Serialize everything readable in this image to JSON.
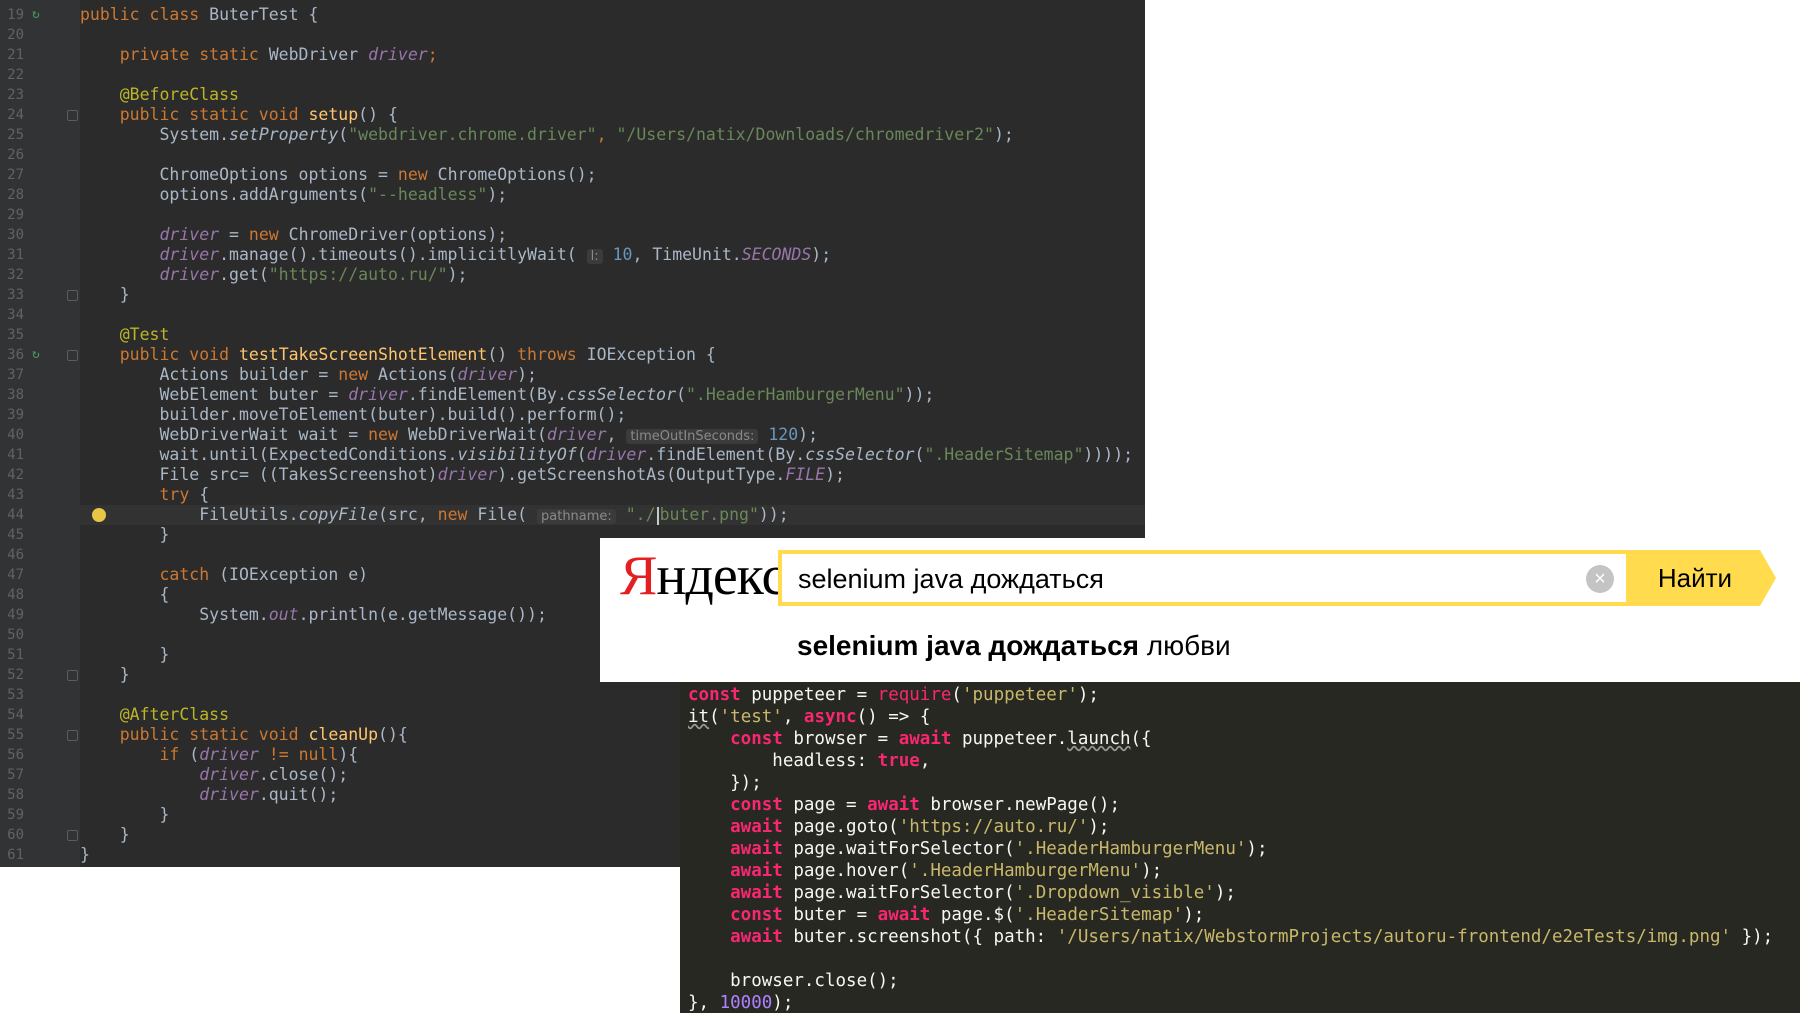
{
  "java_editor": {
    "lines": [
      {
        "n": "19",
        "t": [
          [
            "k",
            "public class "
          ],
          [
            "",
            "ButerTest {"
          ]
        ]
      },
      {
        "n": "20",
        "t": []
      },
      {
        "n": "21",
        "t": [
          [
            "k",
            "    private static "
          ],
          [
            "",
            "WebDriver "
          ],
          [
            "pi",
            "driver"
          ],
          [
            "k",
            ";"
          ]
        ]
      },
      {
        "n": "22",
        "t": []
      },
      {
        "n": "23",
        "t": [
          [
            "a",
            "    @BeforeClass"
          ]
        ]
      },
      {
        "n": "24",
        "t": [
          [
            "k",
            "    public static void "
          ],
          [
            "f",
            "setup"
          ],
          [
            "",
            "() {"
          ]
        ]
      },
      {
        "n": "25",
        "t": [
          [
            "",
            "        System."
          ],
          [
            "i",
            "setProperty"
          ],
          [
            "",
            "("
          ],
          [
            "s",
            "\"webdriver.chrome.driver\""
          ],
          [
            "k",
            ", "
          ],
          [
            "s",
            "\"/Users/natix/Downloads/chromedriver2\""
          ],
          [
            "",
            ");"
          ]
        ]
      },
      {
        "n": "26",
        "t": []
      },
      {
        "n": "27",
        "t": [
          [
            "",
            "        ChromeOptions options = "
          ],
          [
            "k",
            "new "
          ],
          [
            "",
            "ChromeOptions();"
          ]
        ]
      },
      {
        "n": "28",
        "t": [
          [
            "",
            "        options.addArguments("
          ],
          [
            "s",
            "\"--headless\""
          ],
          [
            "",
            ");"
          ]
        ]
      },
      {
        "n": "29",
        "t": []
      },
      {
        "n": "30",
        "t": [
          [
            "pi",
            "        driver"
          ],
          [
            "",
            ""
          ],
          [
            "",
            " = "
          ],
          [
            "k",
            "new "
          ],
          [
            "",
            "ChromeDriver(options);"
          ]
        ]
      },
      {
        "n": "31",
        "t": [
          [
            "pi",
            "        driver"
          ],
          [
            "",
            ".manage().timeouts().implicitlyWait( "
          ],
          [
            "h",
            "l:"
          ],
          [
            "n",
            " 10"
          ],
          [
            "",
            ", TimeUnit."
          ],
          [
            "pi",
            "SECONDS"
          ],
          [
            "",
            ");"
          ]
        ]
      },
      {
        "n": "32",
        "t": [
          [
            "pi",
            "        driver"
          ],
          [
            "",
            ".get("
          ],
          [
            "s",
            "\"https://auto.ru/\""
          ],
          [
            "",
            ");"
          ]
        ]
      },
      {
        "n": "33",
        "t": [
          [
            "",
            "    }"
          ]
        ]
      },
      {
        "n": "34",
        "t": []
      },
      {
        "n": "35",
        "t": [
          [
            "a",
            "    @Test"
          ]
        ]
      },
      {
        "n": "36",
        "t": [
          [
            "k",
            "    public void "
          ],
          [
            "f",
            "testTakeScreenShotElement"
          ],
          [
            "",
            "() "
          ],
          [
            "k",
            "throws "
          ],
          [
            "",
            "IOException {"
          ]
        ]
      },
      {
        "n": "37",
        "t": [
          [
            "",
            "        Actions builder = "
          ],
          [
            "k",
            "new "
          ],
          [
            "",
            "Actions("
          ],
          [
            "pi",
            "driver"
          ],
          [
            "",
            ");"
          ]
        ]
      },
      {
        "n": "38",
        "t": [
          [
            "",
            "        WebElement buter = "
          ],
          [
            "pi",
            "driver"
          ],
          [
            "",
            ".findElement(By."
          ],
          [
            "i",
            "cssSelector"
          ],
          [
            "",
            "("
          ],
          [
            "s",
            "\".HeaderHamburgerMenu\""
          ],
          [
            "",
            "));"
          ]
        ]
      },
      {
        "n": "39",
        "t": [
          [
            "",
            "        builder.moveToElement(buter).build().perform();"
          ]
        ]
      },
      {
        "n": "40",
        "t": [
          [
            "",
            "        WebDriverWait wait = "
          ],
          [
            "k",
            "new "
          ],
          [
            "",
            "WebDriverWait("
          ],
          [
            "pi",
            "driver"
          ],
          [
            "",
            ", "
          ],
          [
            "h",
            "timeOutInSeconds:"
          ],
          [
            "n",
            " 120"
          ],
          [
            "",
            ");"
          ]
        ]
      },
      {
        "n": "41",
        "t": [
          [
            "",
            "        wait.until(ExpectedConditions."
          ],
          [
            "i",
            "visibilityOf"
          ],
          [
            "",
            "("
          ],
          [
            "pi",
            "driver"
          ],
          [
            "",
            ".findElement(By."
          ],
          [
            "i",
            "cssSelector"
          ],
          [
            "",
            "("
          ],
          [
            "s",
            "\".HeaderSitemap\""
          ],
          [
            "",
            "))));"
          ]
        ]
      },
      {
        "n": "42",
        "t": [
          [
            "",
            "        File src= ((TakesScreenshot)"
          ],
          [
            "pi",
            "driver"
          ],
          [
            "",
            ").getScreenshotAs(OutputType."
          ],
          [
            "pi",
            "FILE"
          ],
          [
            "",
            ");"
          ]
        ]
      },
      {
        "n": "43",
        "t": [
          [
            "k",
            "        try "
          ],
          [
            "",
            "{"
          ]
        ]
      },
      {
        "n": "44",
        "t": [
          [
            "",
            "            FileUtils."
          ],
          [
            "i",
            "copyFile"
          ],
          [
            "",
            "(src, "
          ],
          [
            "k",
            "new "
          ],
          [
            "",
            "File( "
          ],
          [
            "h",
            "pathname:"
          ],
          [
            "s",
            " \"./"
          ],
          [
            "c",
            ""
          ],
          [
            "s",
            "buter.png\""
          ],
          [
            "",
            "));"
          ]
        ]
      },
      {
        "n": "45",
        "t": [
          [
            "",
            "        }"
          ]
        ]
      },
      {
        "n": "46",
        "t": []
      },
      {
        "n": "47",
        "t": [
          [
            "k",
            "        catch "
          ],
          [
            "",
            "(IOException e)"
          ]
        ]
      },
      {
        "n": "48",
        "t": [
          [
            "",
            "        {"
          ]
        ]
      },
      {
        "n": "49",
        "t": [
          [
            "",
            "            System."
          ],
          [
            "pi",
            "out"
          ],
          [
            "",
            ".println(e.getMessage());"
          ]
        ]
      },
      {
        "n": "50",
        "t": []
      },
      {
        "n": "51",
        "t": [
          [
            "",
            "        }"
          ]
        ]
      },
      {
        "n": "52",
        "t": [
          [
            "",
            "    }"
          ]
        ]
      },
      {
        "n": "53",
        "t": []
      },
      {
        "n": "54",
        "t": [
          [
            "a",
            "    @AfterClass"
          ]
        ]
      },
      {
        "n": "55",
        "t": [
          [
            "k",
            "    public static void "
          ],
          [
            "f",
            "cleanUp"
          ],
          [
            "",
            "(){"
          ]
        ]
      },
      {
        "n": "56",
        "t": [
          [
            "k",
            "        if "
          ],
          [
            "",
            "("
          ],
          [
            "pi",
            "driver"
          ],
          [
            "k",
            " != null"
          ],
          [
            "",
            "){"
          ]
        ]
      },
      {
        "n": "57",
        "t": [
          [
            "pi",
            "            driver"
          ],
          [
            "",
            ".close();"
          ]
        ]
      },
      {
        "n": "58",
        "t": [
          [
            "pi",
            "            driver"
          ],
          [
            "",
            ".quit();"
          ]
        ]
      },
      {
        "n": "59",
        "t": [
          [
            "",
            "        }"
          ]
        ]
      },
      {
        "n": "60",
        "t": [
          [
            "",
            "    }"
          ]
        ]
      },
      {
        "n": "61",
        "t": [
          [
            "",
            "}"
          ]
        ]
      }
    ]
  },
  "yandex": {
    "logo_first": "Я",
    "logo_rest": "ндекс",
    "query": "selenium java дождаться",
    "clear_symbol": "×",
    "search_button": "Найти",
    "suggestion_bold": "selenium java дождаться",
    "suggestion_rest": " любви"
  },
  "js_editor": {
    "lines": [
      {
        "t": [
          [
            "jk",
            "const "
          ],
          [
            "",
            "puppeteer = "
          ],
          [
            "jm",
            "require"
          ],
          [
            "",
            "("
          ],
          [
            "s",
            "'puppeteer'"
          ],
          [
            "",
            ");"
          ]
        ]
      },
      {
        "t": [
          [
            "u",
            "it"
          ],
          [
            "",
            "("
          ],
          [
            "s",
            "'test'"
          ],
          [
            "",
            ", "
          ],
          [
            "jk",
            "async"
          ],
          [
            "",
            "() => {"
          ]
        ]
      },
      {
        "t": [
          [
            "jk",
            "    const "
          ],
          [
            "",
            "browser = "
          ],
          [
            "jk",
            "await "
          ],
          [
            "",
            "puppeteer."
          ],
          [
            "u",
            "launch"
          ],
          [
            "",
            "({"
          ]
        ]
      },
      {
        "t": [
          [
            "",
            "        headless: "
          ],
          [
            "jk",
            "true"
          ],
          [
            "",
            ","
          ]
        ]
      },
      {
        "t": [
          [
            "",
            "    });"
          ]
        ]
      },
      {
        "t": [
          [
            "jk",
            "    const "
          ],
          [
            "",
            "page = "
          ],
          [
            "jk",
            "await "
          ],
          [
            "",
            "browser.newPage();"
          ]
        ]
      },
      {
        "t": [
          [
            "jk",
            "    await "
          ],
          [
            "",
            "page.goto("
          ],
          [
            "s",
            "'https://auto.ru/'"
          ],
          [
            "",
            ");"
          ]
        ]
      },
      {
        "t": [
          [
            "jk",
            "    await "
          ],
          [
            "",
            "page.waitForSelector("
          ],
          [
            "s",
            "'.HeaderHamburgerMenu'"
          ],
          [
            "",
            ");"
          ]
        ]
      },
      {
        "t": [
          [
            "jk",
            "    await "
          ],
          [
            "",
            "page.hover("
          ],
          [
            "s",
            "'.HeaderHamburgerMenu'"
          ],
          [
            "",
            ");"
          ]
        ]
      },
      {
        "t": [
          [
            "jk",
            "    await "
          ],
          [
            "",
            "page.waitForSelector("
          ],
          [
            "s",
            "'.Dropdown_visible'"
          ],
          [
            "",
            ");"
          ]
        ]
      },
      {
        "t": [
          [
            "jk",
            "    const "
          ],
          [
            "",
            "buter = "
          ],
          [
            "jk",
            "await "
          ],
          [
            "",
            "page.$("
          ],
          [
            "s",
            "'.HeaderSitemap'"
          ],
          [
            "",
            ");"
          ]
        ]
      },
      {
        "t": [
          [
            "jk",
            "    await "
          ],
          [
            "",
            "buter.screenshot({ path: "
          ],
          [
            "s",
            "'/Users/natix/WebstormProjects/autoru-frontend/e2eTests/img.png'"
          ],
          [
            "",
            " });"
          ]
        ]
      },
      {
        "t": []
      },
      {
        "t": [
          [
            "",
            "    browser.close();"
          ]
        ]
      },
      {
        "t": [
          [
            "",
            "}, "
          ],
          [
            "jn",
            "10000"
          ],
          [
            "",
            ");"
          ]
        ]
      }
    ]
  }
}
